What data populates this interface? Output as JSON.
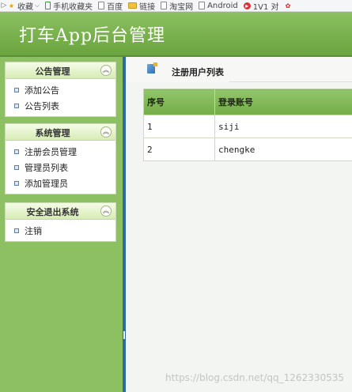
{
  "bookmarks": [
    {
      "label": "收藏",
      "icon": "star-icon"
    },
    {
      "label": "手机收藏夹",
      "icon": "phone-icon"
    },
    {
      "label": "百度",
      "icon": "page-icon"
    },
    {
      "label": "链接",
      "icon": "folder-icon"
    },
    {
      "label": "淘宝网",
      "icon": "page-icon"
    },
    {
      "label": "Android",
      "icon": "page-icon"
    },
    {
      "label": "1V1 对",
      "icon": "circle-play-icon"
    }
  ],
  "header": {
    "title": "打车App后台管理"
  },
  "sidebar": {
    "panels": [
      {
        "title": "公告管理",
        "items": [
          "添加公告",
          "公告列表"
        ]
      },
      {
        "title": "系统管理",
        "items": [
          "注册会员管理",
          "管理员列表",
          "添加管理员"
        ]
      },
      {
        "title": "安全退出系统",
        "items": [
          "注销"
        ]
      }
    ]
  },
  "main": {
    "title": "注册用户列表",
    "table": {
      "headers": [
        "序号",
        "登录账号"
      ],
      "rows": [
        [
          "1",
          "siji"
        ],
        [
          "2",
          "chengke"
        ]
      ]
    }
  },
  "watermark": "https://blog.csdn.net/qq_1262330535"
}
